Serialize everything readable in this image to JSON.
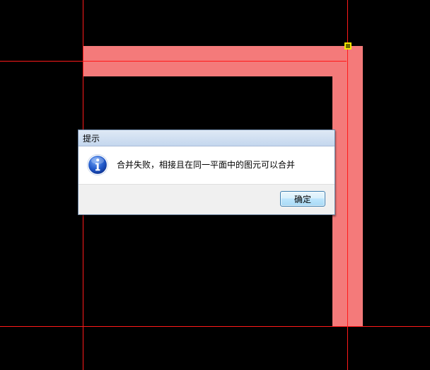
{
  "canvas": {
    "background": "#000000",
    "wall_fill_color": "#f47a7a",
    "grid_line_color": "#ff1a1a",
    "grip_color": "#f5e600"
  },
  "dialog": {
    "title": "提示",
    "icon": "info-icon",
    "message": "合并失败，相接且在同一平面中的图元可以合并",
    "ok_label": "确定"
  }
}
